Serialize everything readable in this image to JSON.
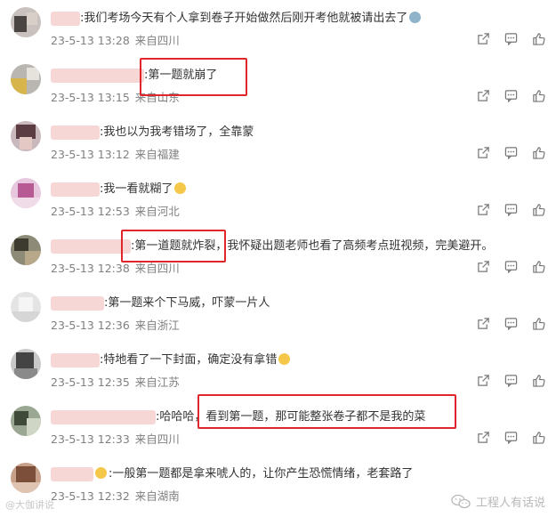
{
  "comments": [
    {
      "text": ":我们考场今天有个人拿到卷子开始做然后刚开考他就被请出去了",
      "date": "23-5-13 13:28",
      "location": "来自四川"
    },
    {
      "text": ":第一题就崩了",
      "date": "23-5-13 13:15",
      "location": "来自山东"
    },
    {
      "text": ":我也以为我考错场了，全靠蒙",
      "date": "23-5-13 13:12",
      "location": "来自福建"
    },
    {
      "text": ":我一看就糊了",
      "date": "23-5-13 12:53",
      "location": "来自河北"
    },
    {
      "text": ":第一道题就炸裂，我怀疑出题老师也看了高频考点班视频，完美避开。",
      "date": "23-5-13 12:38",
      "location": "来自四川"
    },
    {
      "text": ":第一题来个下马威，吓蒙一片人",
      "date": "23-5-13 12:36",
      "location": "来自浙江"
    },
    {
      "text": ":特地看了一下封面，确定没有拿错",
      "date": "23-5-13 12:35",
      "location": "来自江苏"
    },
    {
      "text": ":哈哈哈，看到第一题，那可能整张卷子都不是我的菜",
      "date": "23-5-13 12:33",
      "location": "来自四川"
    },
    {
      "text": ":一般第一题都是拿来唬人的，让你产生恐慌情绪，老套路了",
      "date": "23-5-13 12:32",
      "location": "来自湖南"
    }
  ],
  "watermark_left": "@大伽讲说",
  "watermark_right": "工程人有话说",
  "colors": {
    "highlight": "#e0262a",
    "meta": "#808080",
    "text": "#333333"
  }
}
